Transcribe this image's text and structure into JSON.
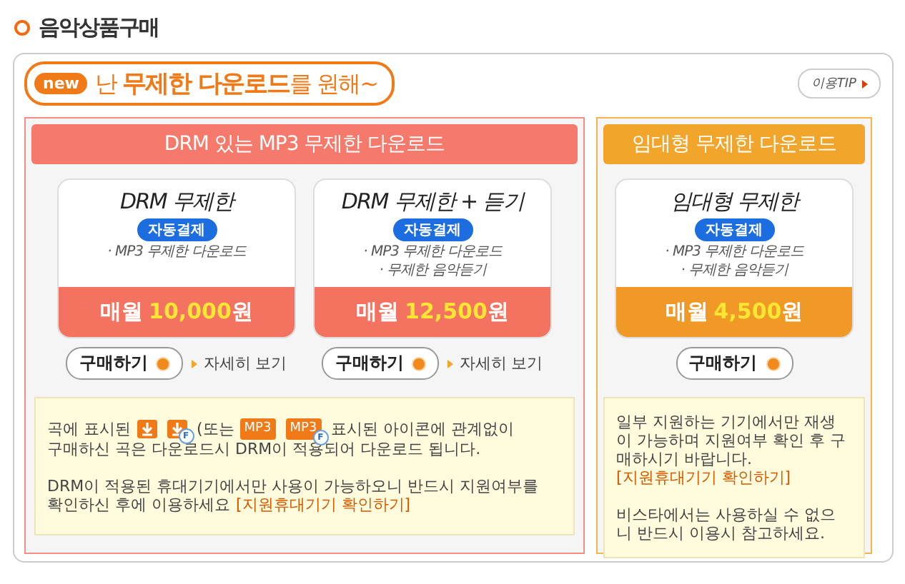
{
  "page_title": "음악상품구매",
  "banner": {
    "badge": "new",
    "text": "난 **무제한 다운로드**를 원해~"
  },
  "tip_button": "이용TIP",
  "sections": [
    {
      "color": "#f57a6b",
      "header": "DRM 있는 MP3 무제한 다운로드",
      "plans": [
        {
          "name": "DRM 무제한",
          "auto_pay": "자동결제",
          "features": [
            "· MP3 무제한 다운로드"
          ],
          "price": {
            "prefix": "매월",
            "amount": "10,000",
            "unit": "원"
          },
          "buy": "구매하기",
          "detail": "자세히 보기"
        },
        {
          "name": "DRM 무제한 + 듣기",
          "auto_pay": "자동결제",
          "features": [
            "· MP3 무제한 다운로드",
            "· 무제한 음악듣기"
          ],
          "price": {
            "prefix": "매월",
            "amount": "12,500",
            "unit": "원"
          },
          "buy": "구매하기",
          "detail": "자세히 보기"
        }
      ],
      "note": [
        [
          [
            {
              "kind": "text",
              "text": "곡에 표시된"
            },
            {
              "kind": "download-icon"
            },
            {
              "kind": "download-icon",
              "badge": "F"
            },
            {
              "kind": "text",
              "text": "(또는"
            },
            {
              "kind": "mp3-badge",
              "text": "MP3"
            },
            {
              "kind": "mp3-badge",
              "text": "MP3",
              "badge": "F"
            },
            {
              "kind": "text",
              "text": "표시된 아이콘에 관계없이"
            }
          ],
          [
            {
              "kind": "text",
              "text": "구매하신 곡은 다운로드시 DRM이 적용되어 다운로드 됩니다."
            }
          ]
        ],
        [
          [
            {
              "kind": "text",
              "text": "DRM이 적용된 휴대기기에서만 사용이 가능하오니 반드시 지원여부를"
            }
          ],
          [
            {
              "kind": "text",
              "text": "확인하신 후에 이용하세요"
            },
            {
              "kind": "link",
              "text": "[지원휴대기기 확인하기]"
            }
          ]
        ]
      ]
    },
    {
      "color": "#f2a52b",
      "header": "임대형 무제한 다운로드",
      "plans": [
        {
          "name": "임대형 무제한",
          "auto_pay": "자동결제",
          "features": [
            "· MP3 무제한 다운로드",
            "· 무제한 음악듣기"
          ],
          "price": {
            "prefix": "매월",
            "amount": "4,500",
            "unit": "원"
          },
          "buy": "구매하기"
        }
      ],
      "note": [
        [
          [
            {
              "kind": "text",
              "text": "일부 지원하는 기기에서만 재생"
            }
          ],
          [
            {
              "kind": "text",
              "text": "이 가능하며 지원여부 확인 후 구"
            }
          ],
          [
            {
              "kind": "text",
              "text": "매하시기 바랍니다."
            }
          ],
          [
            {
              "kind": "link",
              "text": "[지원휴대기기 확인하기]"
            }
          ]
        ],
        [
          [
            {
              "kind": "text",
              "text": "비스타에서는 사용하실 수 없으"
            }
          ],
          [
            {
              "kind": "text",
              "text": "니 반드시 이용시 참고하세요."
            }
          ]
        ]
      ]
    }
  ]
}
